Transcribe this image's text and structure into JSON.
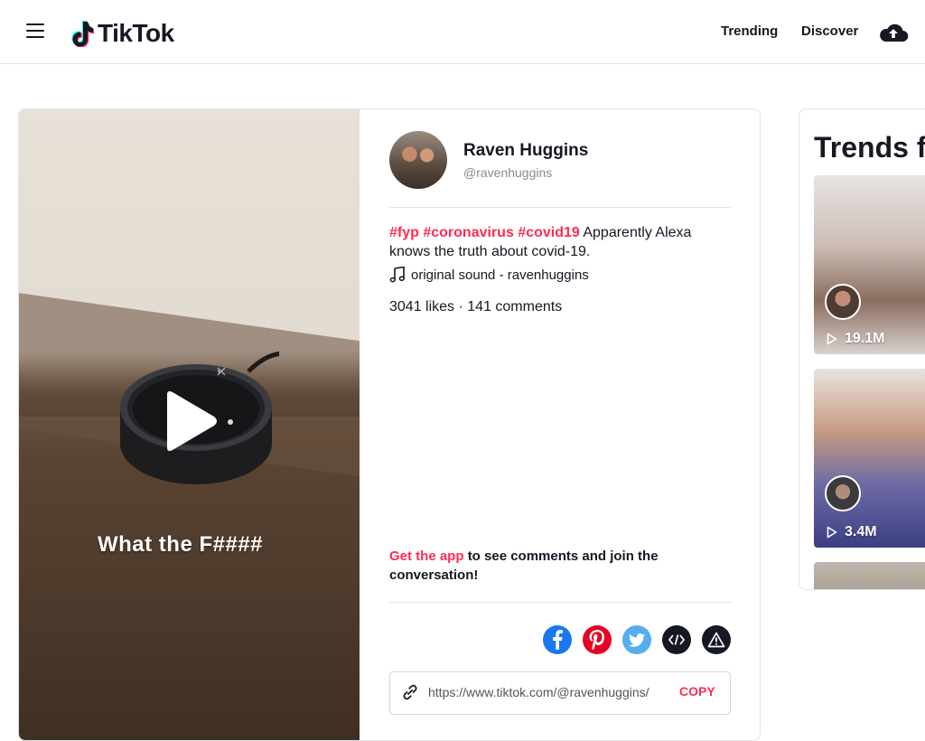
{
  "header": {
    "logo_text": "TikTok",
    "nav": [
      {
        "label": "Trending"
      },
      {
        "label": "Discover"
      }
    ]
  },
  "video": {
    "caption": "What the F####",
    "author": {
      "name": "Raven Huggins",
      "handle": "@ravenhuggins"
    },
    "description": {
      "tags": [
        "#fyp",
        "#coronavirus",
        "#covid19"
      ],
      "text": "Apparently Alexa knows the truth about covid-19."
    },
    "music": "original sound - ravenhuggins",
    "stats": "3041 likes · 141 comments",
    "get_app": {
      "link": "Get the app",
      "text": "to see comments and join the conversation!"
    },
    "share_icons": [
      "facebook-icon",
      "pinterest-icon",
      "twitter-icon",
      "embed-icon",
      "report-icon"
    ],
    "link_url": "https://www.tiktok.com/@ravenhuggins/",
    "copy_label": "COPY"
  },
  "trends": {
    "title": "Trends f",
    "items": [
      {
        "views": "19.1M"
      },
      {
        "views": "3.4M"
      },
      {
        "views": ""
      }
    ]
  },
  "colors": {
    "accent": "#fe2c55",
    "facebook": "#1877f2",
    "pinterest": "#e60023",
    "twitter": "#55acee",
    "dark": "#161823"
  }
}
